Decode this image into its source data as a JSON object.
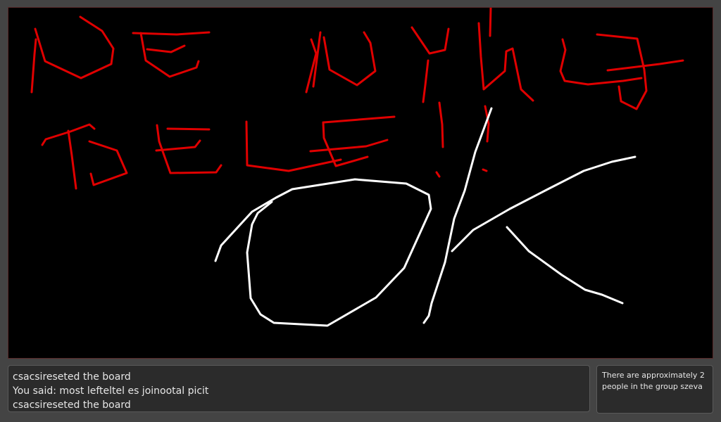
{
  "colors": {
    "board_bg": "#000000",
    "red_ink": "#e00000",
    "white_ink": "#ffffff",
    "panel_bg": "#2b2b2b",
    "page_bg": "#444444"
  },
  "chat": {
    "lines": [
      "csacsireseted the board",
      "You said: most lefteltel es joinootal picit",
      "csacsireseted the board"
    ]
  },
  "group_info": {
    "text": "There are approximately 2 people in the group szeva"
  }
}
